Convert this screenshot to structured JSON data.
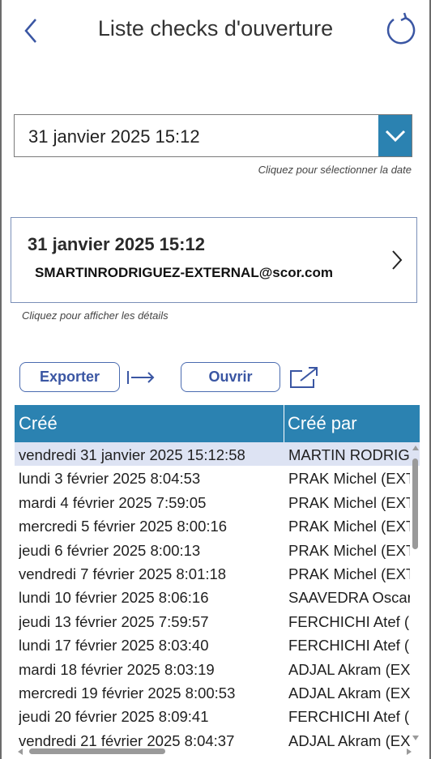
{
  "header": {
    "title": "Liste checks d'ouverture"
  },
  "date_picker": {
    "value": "31 janvier 2025 15:12",
    "hint": "Cliquez pour sélectionner la date"
  },
  "summary_card": {
    "date": "31 janvier 2025 15:12",
    "user": "SMARTINRODRIGUEZ-EXTERNAL@scor.com",
    "hint": "Cliquez pour afficher les détails"
  },
  "actions": {
    "export_label": "Exporter",
    "open_label": "Ouvrir"
  },
  "table": {
    "columns": [
      "Créé",
      "Créé par"
    ],
    "rows": [
      {
        "created": "vendredi 31 janvier 2025 15:12:58",
        "by": "MARTIN RODRIG"
      },
      {
        "created": "lundi 3 février 2025 8:04:53",
        "by": "PRAK Michel (EXT"
      },
      {
        "created": "mardi 4 février 2025 7:59:05",
        "by": "PRAK Michel (EXT"
      },
      {
        "created": "mercredi 5 février 2025 8:00:16",
        "by": "PRAK Michel (EXT"
      },
      {
        "created": "jeudi 6 février 2025 8:00:13",
        "by": "PRAK Michel (EXT"
      },
      {
        "created": "vendredi 7 février 2025 8:01:18",
        "by": "PRAK Michel (EXT"
      },
      {
        "created": "lundi 10 février 2025 8:06:16",
        "by": "SAAVEDRA Oscar"
      },
      {
        "created": "jeudi 13 février 2025 7:59:57",
        "by": "FERCHICHI Atef ("
      },
      {
        "created": "lundi 17 février 2025 8:03:40",
        "by": "FERCHICHI Atef ("
      },
      {
        "created": "mardi 18 février 2025 8:03:19",
        "by": "ADJAL Akram (EX"
      },
      {
        "created": "mercredi 19 février 2025 8:00:53",
        "by": "ADJAL Akram (EX"
      },
      {
        "created": "jeudi 20 février 2025 8:09:41",
        "by": "FERCHICHI Atef ("
      },
      {
        "created": "vendredi 21 février 2025 8:04:37",
        "by": "ADJAL Akram (EX"
      }
    ]
  },
  "colors": {
    "accent": "#2b82b1",
    "selected_row": "#dde3f3",
    "button_border": "#4a6bb0"
  }
}
